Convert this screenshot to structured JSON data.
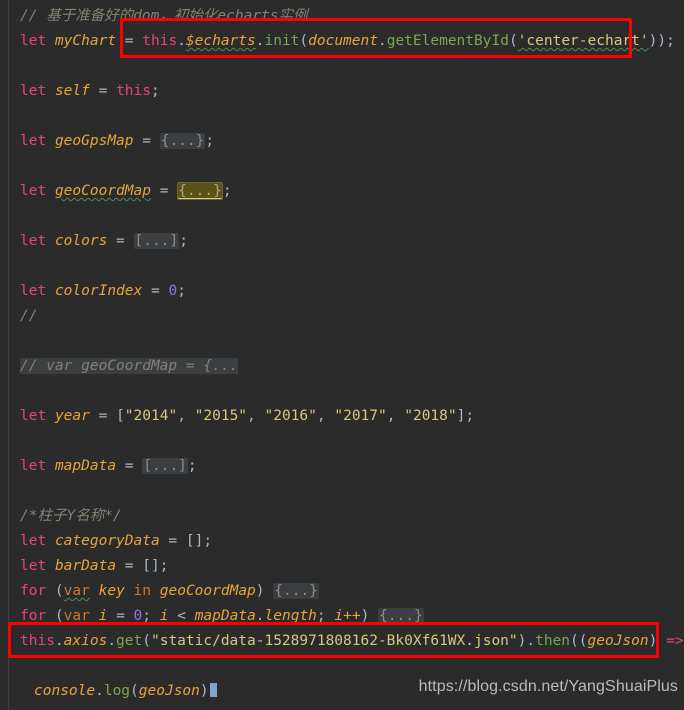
{
  "editor": {
    "theme": "darcula",
    "background": "#2b2b2b",
    "colors": {
      "keyword": "#e8447c",
      "identifier": "#e8a33d",
      "string": "#d9c77c",
      "number": "#8d7ae0",
      "comment": "#808274",
      "function": "#7aa84f",
      "annotation_box": "#ff0000",
      "fold_placeholder": "#3c3f41",
      "fold_placeholder_active": "#585219"
    }
  },
  "lines": {
    "l01_comment": "// 基于准备好的dom，初始化echarts实例",
    "l02": {
      "let": "let",
      "name": "myChart",
      "eq": " = ",
      "this": "this",
      "echarts": "$echarts",
      "init": "init",
      "document": "document",
      "getElementById": "getElementById",
      "arg": "'center-echart'",
      "tail": "));"
    },
    "l03": {
      "let": "let",
      "name": "self",
      "eq": " = ",
      "this": "this",
      "semi": ";"
    },
    "l04": {
      "let": "let",
      "name": "geoGpsMap",
      "eq": " = ",
      "fold": "{...}",
      "semi": ";"
    },
    "l05": {
      "let": "let",
      "name": "geoCoordMap",
      "eq": " = ",
      "fold": "{...}",
      "semi": ";"
    },
    "l06": {
      "let": "let",
      "name": "colors",
      "eq": " = ",
      "fold": "[...]",
      "semi": ";"
    },
    "l07": {
      "let": "let",
      "name": "colorIndex",
      "eq": " = ",
      "num": "0",
      "semi": ";"
    },
    "l08_comment": "//",
    "l09_comment": "// var geoCoordMap = {...",
    "l10": {
      "let": "let",
      "name": "year",
      "eq": " = ",
      "open": "[",
      "values": [
        "\"2014\"",
        "\"2015\"",
        "\"2016\"",
        "\"2017\"",
        "\"2018\""
      ],
      "close": "];"
    },
    "l11": {
      "let": "let",
      "name": "mapData",
      "eq": " = ",
      "fold": "[...]",
      "semi": ";"
    },
    "l12_comment": "/*柱子Y名称*/",
    "l13": {
      "let": "let",
      "name": "categoryData",
      "eq": " = ",
      "val": "[]",
      "semi": ";"
    },
    "l14": {
      "let": "let",
      "name": "barData",
      "eq": " = ",
      "val": "[]",
      "semi": ";"
    },
    "l15": {
      "for": "for",
      "open": " (",
      "var": "var",
      "key": "key",
      "in": "in",
      "obj": "geoCoordMap",
      "close": ") ",
      "fold": "{...}"
    },
    "l16": {
      "for": "for",
      "open": " (",
      "var": "var",
      "i": "i",
      "eq": " = ",
      "zero": "0",
      "semi1": "; ",
      "i2": "i",
      "lt": " < ",
      "mapData": "mapData",
      "dot": ".",
      "length": "length",
      "semi2": "; ",
      "inc": "i++",
      "close": ") ",
      "fold": "{...}"
    },
    "l17": {
      "this": "this",
      "dot1": ".",
      "axios": "axios",
      "dot2": ".",
      "get": "get",
      "open": "(",
      "url": "\"static/data-1528971808162-Bk0Xf61WX.json\"",
      "close": ")",
      "dot3": ".",
      "then": "then",
      "open2": "((",
      "param": "geoJson",
      "close2": ") ",
      "arrow": "=>",
      "brace": " {"
    },
    "l18": {
      "console": "console",
      "dot": ".",
      "log": "log",
      "open": "(",
      "arg": "geoJson",
      "close": ")"
    }
  },
  "watermark": "https://blog.csdn.net/YangShuaiPlus"
}
